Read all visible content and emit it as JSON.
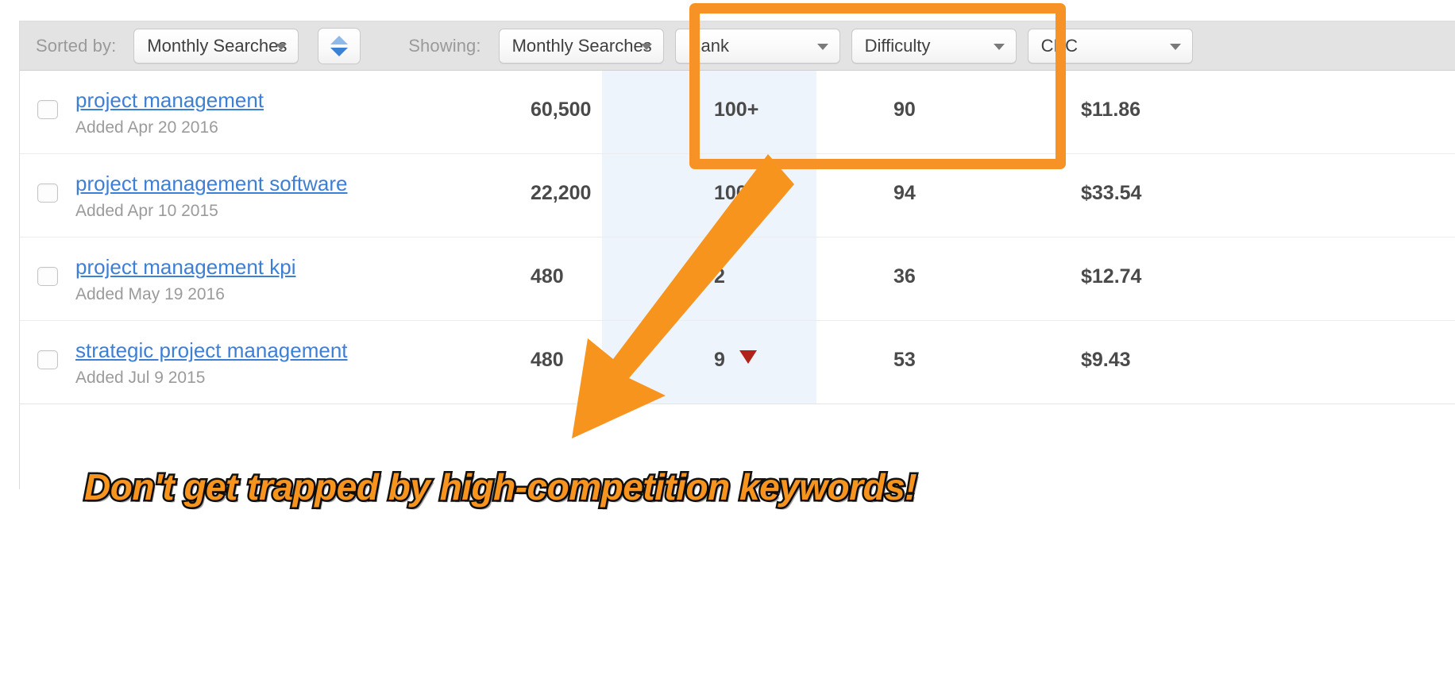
{
  "toolbar": {
    "sorted_by_label": "Sorted by:",
    "sorted_by_value": "Monthly Searches",
    "sort_direction_icon": "sort-updown-icon",
    "showing_label": "Showing:",
    "showing_value": "Monthly Searches",
    "rank_value": "Rank",
    "difficulty_value": "Difficulty",
    "cpc_value": "CPC"
  },
  "table": {
    "rows": [
      {
        "checkbox": "unchecked",
        "keyword": "project management",
        "added": "Added Apr 20 2016",
        "monthly_searches": "60,500",
        "rank": "100+",
        "rank_trend": "",
        "difficulty": "90",
        "cpc": "$11.86"
      },
      {
        "checkbox": "unchecked",
        "keyword": "project management software",
        "added": "Added Apr 10 2015",
        "monthly_searches": "22,200",
        "rank": "100+",
        "rank_trend": "",
        "difficulty": "94",
        "cpc": "$33.54"
      },
      {
        "checkbox": "unchecked",
        "keyword": "project management kpi",
        "added": "Added May 19 2016",
        "monthly_searches": "480",
        "rank": "2",
        "rank_trend": "",
        "difficulty": "36",
        "cpc": "$12.74"
      },
      {
        "checkbox": "unchecked",
        "keyword": "strategic project management",
        "added": "Added Jul 9 2015",
        "monthly_searches": "480",
        "rank": "9",
        "rank_trend": "down",
        "difficulty": "53",
        "cpc": "$9.43"
      }
    ]
  },
  "annotation": {
    "caption": "Don't get trapped by high-competition keywords!",
    "highlight_color": "#f79226",
    "caption_color": "#f7941e",
    "caption_outline_color": "#111111",
    "arrow_color": "#f7941e"
  },
  "colors": {
    "link": "#3e7fd6",
    "toolbar_bg": "#e3e3e3",
    "highlight_column": "#eef4fc",
    "rank_down_arrow": "#b02318",
    "sort_up_arrow": "#8fb9e8",
    "sort_down_arrow": "#3b82d6"
  }
}
